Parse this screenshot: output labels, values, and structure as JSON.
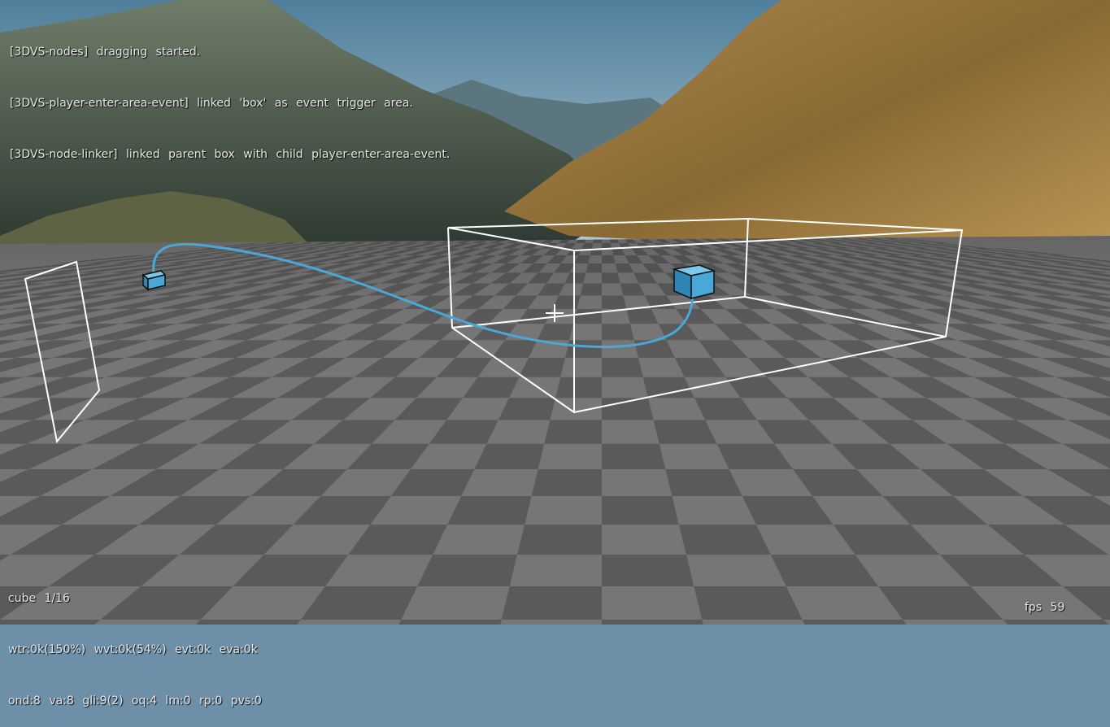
{
  "console_log": [
    "[3DVS-nodes] dragging started.",
    "[3DVS-player-enter-area-event] linked 'box' as event trigger area.",
    "[3DVS-node-linker] linked parent box with child player-enter-area-event."
  ],
  "stats": {
    "line1": "cube 1/16",
    "line2": "wtr:0k(150%) wvt:0k(54%) evt:0k eva:0k",
    "line3": "ond:8 va:8 gli:9(2) oq:4 lm:0 rp:0 pvs:0"
  },
  "fps_label": "fps 59",
  "colors": {
    "sky_top": "#4f7f9c",
    "sky_horizon": "#b8cdd8",
    "node_cube": "#4aa8d8",
    "link_curve": "#4aa8d8",
    "wireframe": "#ffffff",
    "checker_light": "#8c8c8c",
    "checker_dark": "#5a5a5a"
  },
  "icons": [
    "crosshair-icon"
  ]
}
